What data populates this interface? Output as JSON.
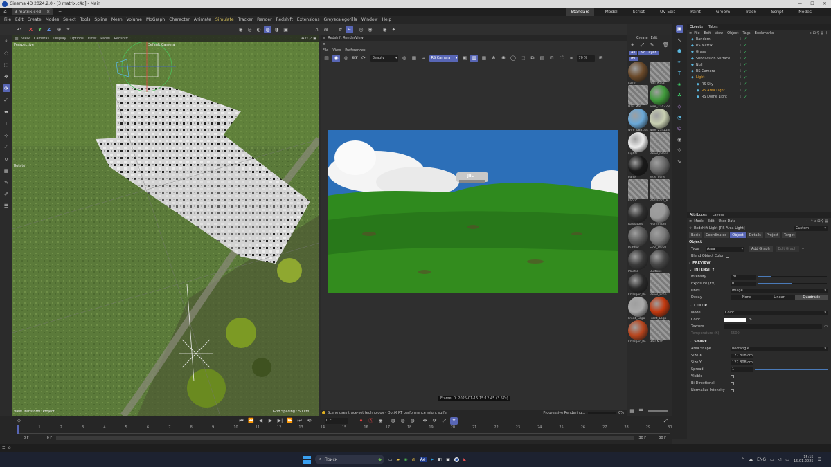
{
  "window": {
    "title": "Cinema 4D 2024.2.0 - [3 matrix.c4d] - Main",
    "controls": [
      "—",
      "☐",
      "✕"
    ]
  },
  "doc_tabs": {
    "active": "3 matrix.c4d"
  },
  "layouts": [
    "Standard",
    "Model",
    "Script",
    "UV Edit",
    "Paint",
    "Groom",
    "Track",
    "Script",
    "Nodes"
  ],
  "menu": [
    "File",
    "Edit",
    "Create",
    "Modes",
    "Select",
    "Tools",
    "Spline",
    "Mesh",
    "Volume",
    "MoGraph",
    "Character",
    "Animate",
    "Simulate",
    "Tracker",
    "Render",
    "Redshift",
    "Extensions",
    "Greyscalegorilla",
    "Window",
    "Help"
  ],
  "axis_buttons": [
    "X",
    "Y",
    "Z"
  ],
  "viewport": {
    "menu": [
      "View",
      "Cameras",
      "Display",
      "Options",
      "Filter",
      "Panel",
      "Redshift"
    ],
    "label": "Perspective",
    "camera": "Default Camera",
    "rotate_label": "Rotate",
    "bottom_left": "View Transform: Project",
    "bottom_right": "Grid Spacing : 50 cm"
  },
  "renderview": {
    "title": "Redshift RenderView",
    "menu": [
      "File",
      "View",
      "Preferences"
    ],
    "aov": "Beauty",
    "camera": "RS Camera",
    "zoom": "70 %",
    "rt_label": "RT",
    "frame_info": "Frame: 0; 2025-01-15 15:12:45 (3.57s)",
    "status": "Scene uses trace-set technology - OptiX RT performance might suffer",
    "progress_label": "Progressive Rendering...",
    "progress_pct": "0%",
    "progress_value": 0,
    "sign_text": "JBL"
  },
  "materials": {
    "menu": [
      "Create",
      "Edit"
    ],
    "filters": [
      "All",
      "No Layer",
      "IBL"
    ],
    "items": [
      {
        "name": "Earth",
        "color": "#6b4a2a"
      },
      {
        "name": "Hair Mat2",
        "color": "checker"
      },
      {
        "name": "Hair Mat",
        "color": "checker"
      },
      {
        "name": "wire_214228",
        "color": "#3f9a3a"
      },
      {
        "name": "wire_088144",
        "color": "#6aa8d8"
      },
      {
        "name": "wire_214228",
        "color": "#c9d0b2"
      },
      {
        "name": "Lights",
        "color": "#ececec"
      },
      {
        "name": "Panel_Glass",
        "color": "checker"
      },
      {
        "name": "Panel",
        "color": "#1a1a1a"
      },
      {
        "name": "Side_Pane",
        "color": "#6a6a6a"
      },
      {
        "name": "Fabric",
        "color": "checker"
      },
      {
        "name": "Radiators_B",
        "color": "checker"
      },
      {
        "name": "Radiators",
        "color": "#2f2f2f"
      },
      {
        "name": "Aluminium",
        "color": "#9a9a9a"
      },
      {
        "name": "Rubber",
        "color": "#5a5a5a"
      },
      {
        "name": "Side_Panel",
        "color": "#7a7a7a"
      },
      {
        "name": "Plastic",
        "color": "#3a3a3a"
      },
      {
        "name": "Buttons",
        "color": "#454545"
      },
      {
        "name": "Charger_Po",
        "color": "#2a2a2a"
      },
      {
        "name": "Panel_Emb",
        "color": "checker"
      },
      {
        "name": "Front_Logo",
        "color": "#aaaaaa"
      },
      {
        "name": "Front_Logo",
        "color": "#c2380e"
      },
      {
        "name": "Charger_Po",
        "color": "#b8451d"
      },
      {
        "name": "Hair Mat",
        "color": "checker"
      }
    ]
  },
  "objects_panel": {
    "tabs": [
      "Objects",
      "Takes"
    ],
    "menu": [
      "File",
      "Edit",
      "View",
      "Object",
      "Tags",
      "Bookmarks"
    ],
    "items": [
      {
        "name": "Random",
        "indent": 0,
        "color": "#c8c8c8"
      },
      {
        "name": "RS Matrix",
        "indent": 0,
        "color": "#c8c8c8"
      },
      {
        "name": "Grass",
        "indent": 0,
        "color": "#c8c8c8"
      },
      {
        "name": "Subdivision Surface",
        "indent": 0,
        "color": "#c8c8c8"
      },
      {
        "name": "Null",
        "indent": 0,
        "color": "#c8c8c8"
      },
      {
        "name": "RS Camera",
        "indent": 0,
        "color": "#c8c8c8"
      },
      {
        "name": "Light",
        "indent": 0,
        "color": "#e0a030"
      },
      {
        "name": "RS Sky",
        "indent": 1,
        "color": "#c8c8c8"
      },
      {
        "name": "RS Area Light",
        "indent": 1,
        "color": "#e0a030"
      },
      {
        "name": "RS Dome Light",
        "indent": 1,
        "color": "#c8c8c8"
      }
    ]
  },
  "attributes": {
    "tabs": [
      "Attributes",
      "Layers"
    ],
    "menu": [
      "Mode",
      "Edit",
      "User Data"
    ],
    "object_title": "Redshift Light [RS Area Light]",
    "preset": "Custom",
    "subtabs": [
      "Basic",
      "Coordinates",
      "Object",
      "Details",
      "Project",
      "Target"
    ],
    "active_subtab": "Object",
    "section_object": "Object",
    "type_label": "Type",
    "type_value": "Area",
    "add_graph": "Add Graph",
    "edit_graph": "Edit Graph",
    "blend_label": "Blend Object Color",
    "preview": "PREVIEW",
    "intensity_section": "INTENSITY",
    "intensity_label": "Intensity",
    "intensity_value": "20",
    "intensity_fill": 0.2,
    "exposure_label": "Exposure (EV)",
    "exposure_value": "0",
    "exposure_fill": 0.5,
    "units_label": "Units",
    "units_value": "Image",
    "decay_label": "Decay",
    "decay_options": [
      "None",
      "Linear",
      "Quadratic"
    ],
    "decay_selected": "Quadratic",
    "color_section": "COLOR",
    "mode_label": "Mode",
    "mode_value": "Color",
    "color_label": "Color",
    "texture_label": "Texture",
    "temperature_label": "Temperature (K)",
    "temperature_value": "6500",
    "shape_section": "SHAPE",
    "area_shape_label": "Area Shape",
    "area_shape_value": "Rectangle",
    "sizex_label": "Size X",
    "sizex_value": "127.808 cm",
    "sizey_label": "Size Y",
    "sizey_value": "127.808 cm",
    "spread_label": "Spread",
    "spread_value": "1",
    "visible_label": "Visible",
    "bidir_label": "Bi-Directional",
    "normalize_label": "Normalize Intensity"
  },
  "timeline": {
    "current_frame": "0 F",
    "start": "0 F",
    "start2": "0 F",
    "end": "30 F",
    "end2": "30 F",
    "ticks": [
      "0",
      "1",
      "2",
      "3",
      "4",
      "5",
      "6",
      "7",
      "8",
      "9",
      "10",
      "11",
      "12",
      "13",
      "14",
      "15",
      "16",
      "17",
      "18",
      "19",
      "20",
      "21",
      "22",
      "23",
      "24",
      "25",
      "26",
      "27",
      "28",
      "29",
      "30"
    ]
  },
  "taskbar": {
    "search": "Поиск",
    "lang": "ENG",
    "time": "15:15",
    "date": "15.01.2025"
  },
  "colors": {
    "accent": "#5866b5",
    "active_layout": "#3a3a3a",
    "sky": "#2c6fb8",
    "grass": "#2f8a1e"
  }
}
